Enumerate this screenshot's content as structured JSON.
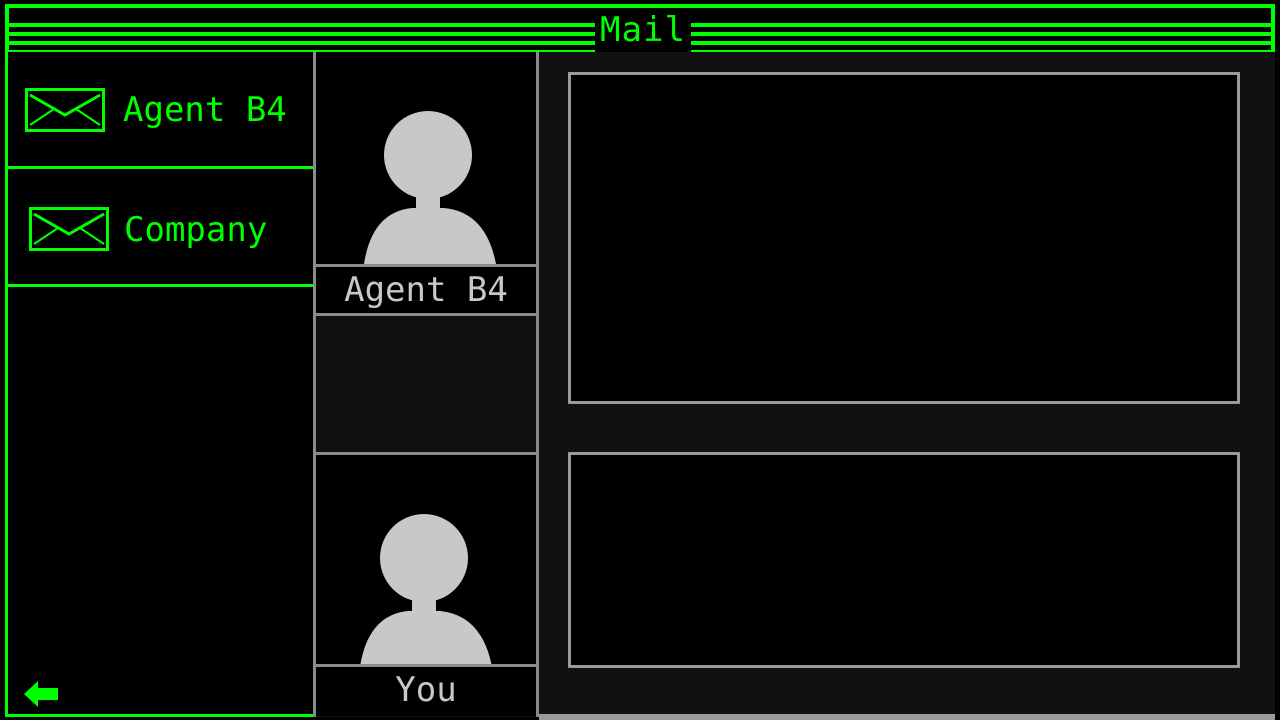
{
  "window": {
    "title": "Mail"
  },
  "contacts": [
    {
      "name": "Agent B4",
      "icon": "envelope-icon"
    },
    {
      "name": "Company",
      "icon": "envelope-icon"
    }
  ],
  "conversation": {
    "sender": {
      "name": "Agent B4",
      "icon": "person-silhouette-icon"
    },
    "recipient": {
      "name": "You",
      "icon": "person-silhouette-icon"
    }
  },
  "navigation": {
    "back_icon": "back-arrow-icon"
  },
  "colors": {
    "accent": "#00ff00",
    "background": "#000000",
    "panel": "#111111",
    "border_gray": "#9a9a9a",
    "silhouette": "#c8c8c8"
  }
}
